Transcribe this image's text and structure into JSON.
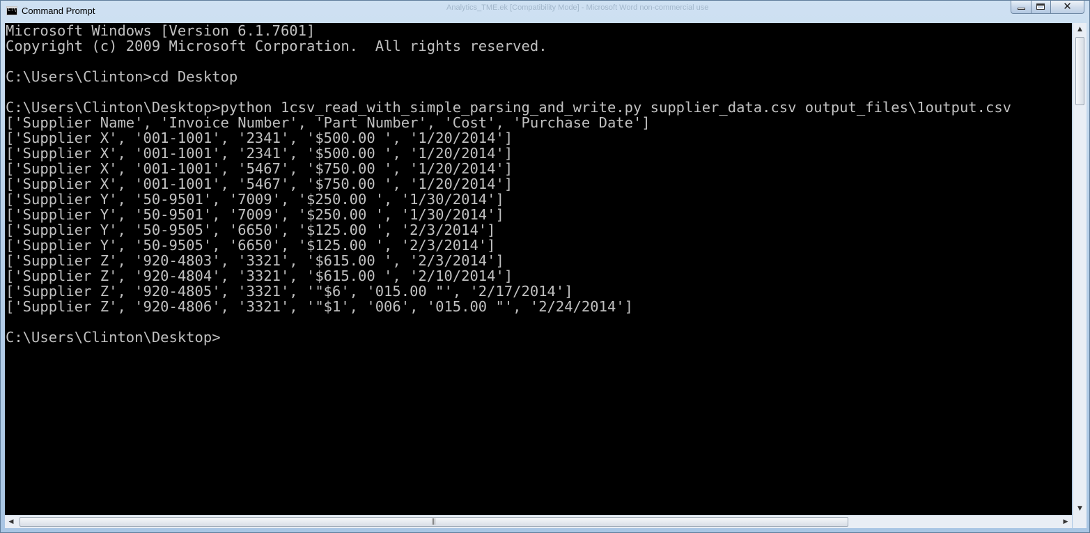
{
  "window": {
    "title": "Command Prompt",
    "background_title": "Analytics_TME.ek [Compatibility Mode] - Microsoft Word non-commercial use",
    "icon": "cmd-app-icon",
    "icon_text": "C:\\",
    "buttons": {
      "minimize_icon": "minimize-icon",
      "maximize_icon": "maximize-icon",
      "close_icon": "close-icon",
      "close_glyph": "✕"
    }
  },
  "console": {
    "text_color": "#c0c0c0",
    "background": "#000000",
    "lines": [
      "Microsoft Windows [Version 6.1.7601]",
      "Copyright (c) 2009 Microsoft Corporation.  All rights reserved.",
      "",
      "C:\\Users\\Clinton>cd Desktop",
      "",
      "C:\\Users\\Clinton\\Desktop>python 1csv_read_with_simple_parsing_and_write.py supplier_data.csv output_files\\1output.csv",
      "['Supplier Name', 'Invoice Number', 'Part Number', 'Cost', 'Purchase Date']",
      "['Supplier X', '001-1001', '2341', '$500.00 ', '1/20/2014']",
      "['Supplier X', '001-1001', '2341', '$500.00 ', '1/20/2014']",
      "['Supplier X', '001-1001', '5467', '$750.00 ', '1/20/2014']",
      "['Supplier X', '001-1001', '5467', '$750.00 ', '1/20/2014']",
      "['Supplier Y', '50-9501', '7009', '$250.00 ', '1/30/2014']",
      "['Supplier Y', '50-9501', '7009', '$250.00 ', '1/30/2014']",
      "['Supplier Y', '50-9505', '6650', '$125.00 ', '2/3/2014']",
      "['Supplier Y', '50-9505', '6650', '$125.00 ', '2/3/2014']",
      "['Supplier Z', '920-4803', '3321', '$615.00 ', '2/3/2014']",
      "['Supplier Z', '920-4804', '3321', '$615.00 ', '2/10/2014']",
      "['Supplier Z', '920-4805', '3321', '\"$6', '015.00 \"', '2/17/2014']",
      "['Supplier Z', '920-4806', '3321', '\"$1', '006', '015.00 \"', '2/24/2014']",
      "",
      "C:\\Users\\Clinton\\Desktop>"
    ]
  },
  "scrollbars": {
    "up_arrow": "▲",
    "down_arrow": "▼",
    "left_arrow": "◀",
    "right_arrow": "▶",
    "grip": "|||"
  }
}
